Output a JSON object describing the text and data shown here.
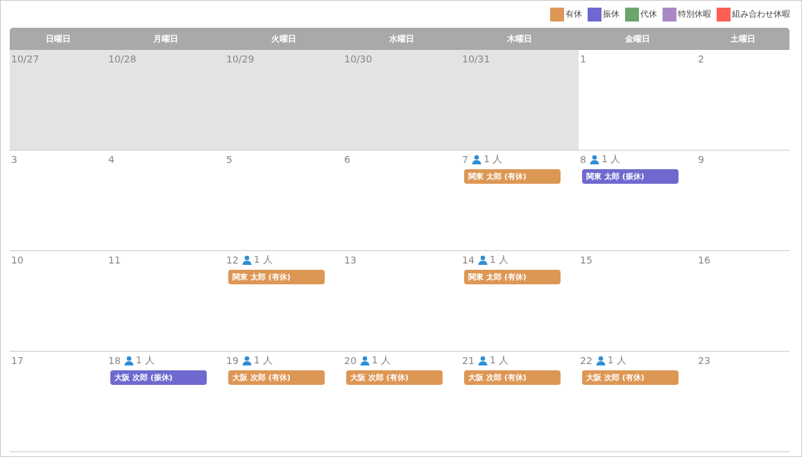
{
  "legend": [
    {
      "label": "有休",
      "color": "#dd9755"
    },
    {
      "label": "振休",
      "color": "#6f69cf"
    },
    {
      "label": "代休",
      "color": "#6ca56c"
    },
    {
      "label": "特別休暇",
      "color": "#aa88c4"
    },
    {
      "label": "組み合わせ休暇",
      "color": "#fd5f55"
    }
  ],
  "weekdays": [
    "日曜日",
    "月曜日",
    "火曜日",
    "水曜日",
    "木曜日",
    "金曜日",
    "土曜日"
  ],
  "weeks": [
    {
      "days": [
        {
          "date": "10/27",
          "other_month": true
        },
        {
          "date": "10/28",
          "other_month": true
        },
        {
          "date": "10/29",
          "other_month": true
        },
        {
          "date": "10/30",
          "other_month": true
        },
        {
          "date": "10/31",
          "other_month": true
        },
        {
          "date": "1",
          "other_month": false
        },
        {
          "date": "2",
          "other_month": false
        }
      ]
    },
    {
      "days": [
        {
          "date": "3",
          "other_month": false
        },
        {
          "date": "4",
          "other_month": false
        },
        {
          "date": "5",
          "other_month": false
        },
        {
          "date": "6",
          "other_month": false
        },
        {
          "date": "7",
          "other_month": false,
          "count": "1 人",
          "events": [
            {
              "label": "関東 太郎 (有休)",
              "color": "#dd9755"
            }
          ]
        },
        {
          "date": "8",
          "other_month": false,
          "count": "1 人",
          "events": [
            {
              "label": "関東 太郎 (振休)",
              "color": "#6f69cf"
            }
          ]
        },
        {
          "date": "9",
          "other_month": false
        }
      ]
    },
    {
      "days": [
        {
          "date": "10",
          "other_month": false
        },
        {
          "date": "11",
          "other_month": false
        },
        {
          "date": "12",
          "other_month": false,
          "count": "1 人",
          "events": [
            {
              "label": "関東 太郎 (有休)",
              "color": "#dd9755"
            }
          ]
        },
        {
          "date": "13",
          "other_month": false
        },
        {
          "date": "14",
          "other_month": false,
          "count": "1 人",
          "events": [
            {
              "label": "関東 太郎 (有休)",
              "color": "#dd9755"
            }
          ]
        },
        {
          "date": "15",
          "other_month": false
        },
        {
          "date": "16",
          "other_month": false
        }
      ]
    },
    {
      "days": [
        {
          "date": "17",
          "other_month": false
        },
        {
          "date": "18",
          "other_month": false,
          "count": "1 人",
          "events": [
            {
              "label": "大阪 次郎 (振休)",
              "color": "#6f69cf"
            }
          ]
        },
        {
          "date": "19",
          "other_month": false,
          "count": "1 人",
          "events": [
            {
              "label": "大阪 次郎 (有休)",
              "color": "#dd9755"
            }
          ]
        },
        {
          "date": "20",
          "other_month": false,
          "count": "1 人",
          "events": [
            {
              "label": "大阪 次郎 (有休)",
              "color": "#dd9755"
            }
          ]
        },
        {
          "date": "21",
          "other_month": false,
          "count": "1 人",
          "events": [
            {
              "label": "大阪 次郎 (有休)",
              "color": "#dd9755"
            }
          ]
        },
        {
          "date": "22",
          "other_month": false,
          "count": "1 人",
          "events": [
            {
              "label": "大阪 次郎 (有休)",
              "color": "#dd9755"
            }
          ]
        },
        {
          "date": "23",
          "other_month": false
        }
      ]
    }
  ]
}
